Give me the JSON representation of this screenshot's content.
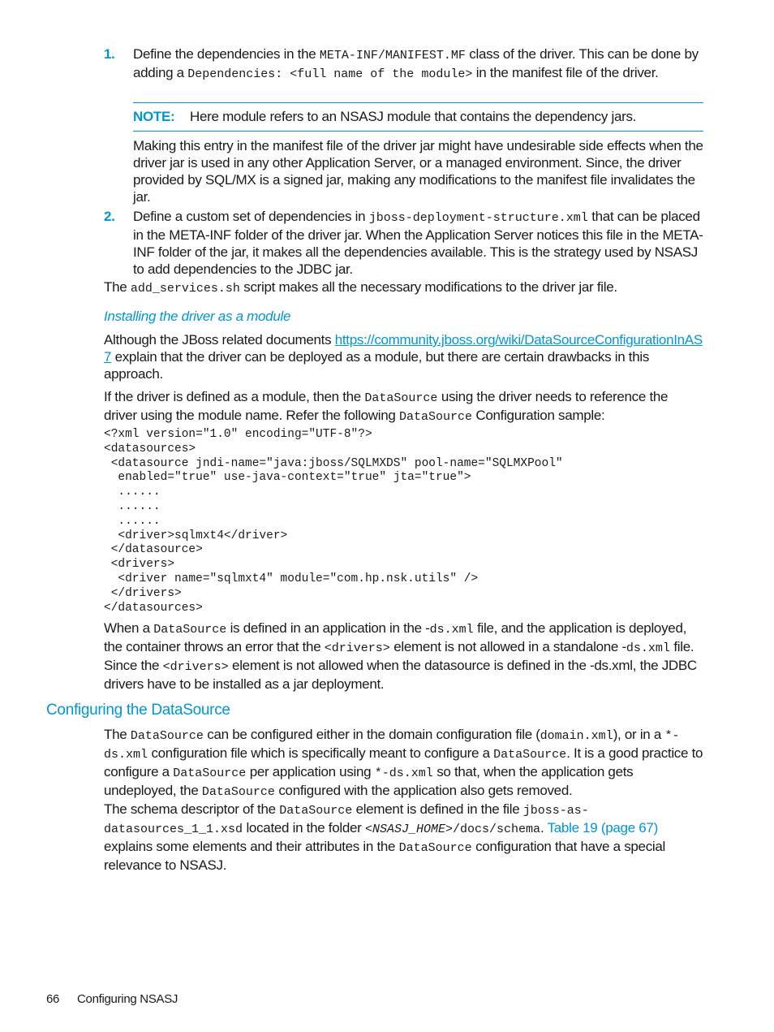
{
  "step1": {
    "number": "1.",
    "text_a": "Define the dependencies in the ",
    "code_a": "META-INF/MANIFEST.MF",
    "text_b": " class of the driver. This can be done by adding a ",
    "code_b": "Dependencies: <full name of the module>",
    "text_c": " in the manifest file of the driver."
  },
  "note": {
    "label": "NOTE:",
    "text": "Here module refers to an NSASJ module that contains the dependency jars."
  },
  "step1_followup": "Making this entry in the manifest file of the driver jar might have undesirable side effects when the driver jar is used in any other Application Server, or a managed environment. Since, the driver provided by SQL/MX is a signed jar, making any modifications to the manifest file invalidates the jar.",
  "step2": {
    "number": "2.",
    "text_a": "Define a custom set of dependencies in ",
    "code_a": "jboss-deployment-structure.xml",
    "text_b": " that can be placed in the META-INF folder of the driver jar. When the Application Server notices this file in the META-INF folder of the jar, it makes all the dependencies available. This is the strategy used by NSASJ to add dependencies to the JDBC jar."
  },
  "add_services": {
    "text_a": "The ",
    "code_a": "add_services.sh",
    "text_b": " script makes all the necessary modifications to the driver jar file."
  },
  "subheading": "Installing the driver as a module",
  "jboss_para": {
    "text_a": "Although the JBoss related documents ",
    "link": "https://community.jboss.org/wiki/DataSourceConfigurationInAS7",
    "text_b": " explain that the driver can be deployed as a module, but there are certain drawbacks in this approach."
  },
  "module_para": {
    "text_a": "If the driver is defined as a module, then the ",
    "code_a": "DataSource",
    "text_b": " using the driver needs to reference the driver using the module name. Refer the following ",
    "code_b": "DataSource",
    "text_c": " Configuration sample:"
  },
  "code_sample": "<?xml version=\"1.0\" encoding=\"UTF-8\"?>\n<datasources>\n <datasource jndi-name=\"java:jboss/SQLMXDS\" pool-name=\"SQLMXPool\"\n  enabled=\"true\" use-java-context=\"true\" jta=\"true\">\n  ......\n  ......\n  ......\n  <driver>sqlmxt4</driver>\n </datasource>\n <drivers>\n  <driver name=\"sqlmxt4\" module=\"com.hp.nsk.utils\" />\n </drivers>\n</datasources>",
  "ds_xml_para": {
    "text_a": "When a ",
    "code_a": "DataSource",
    "text_b": " is defined in an application in the -",
    "code_b": "ds.xml",
    "text_c": " file, and the application is deployed, the container throws an error that the ",
    "code_c": "<drivers>",
    "text_d": " element is not allowed in a standalone -",
    "code_d": "ds.xml",
    "text_e": " file. Since the ",
    "code_e": "<drivers>",
    "text_f": " element is not allowed when the datasource is defined in the -ds.xml, the JDBC drivers have to be installed as a jar deployment."
  },
  "section_heading": "Configuring the DataSource",
  "config_para": {
    "text_a": "The ",
    "code_a": "DataSource",
    "text_b": " can be configured either in the domain configuration file (",
    "code_b": "domain.xml",
    "text_c": "), or in a ",
    "code_c": "*-ds.xml",
    "text_d": " configuration file which is specifically meant to configure a ",
    "code_d": "DataSource",
    "text_e": ". It is a good practice to configure a ",
    "code_e": "DataSource",
    "text_f": " per application using ",
    "code_f": "*-ds.xml",
    "text_g": " so that, when the application gets undeployed, the ",
    "code_g": "DataSource",
    "text_h": " configured with the application also gets removed."
  },
  "schema_para": {
    "text_a": "The schema descriptor of the ",
    "code_a": "DataSource",
    "text_b": " element is defined in the file ",
    "code_b": "jboss-as-datasources_1_1.xsd",
    "text_c": " located in the folder ",
    "code_c_open": "<",
    "code_c_ital": "NSASJ_HOME",
    "code_c_close": ">/docs/schema",
    "text_d": ". ",
    "xref": "Table 19 (page 67)",
    "text_e": " explains some elements and their attributes in the ",
    "code_e": "DataSource",
    "text_f": " configuration that have a special relevance to NSASJ."
  },
  "footer": {
    "page_number": "66",
    "chapter": "Configuring NSASJ"
  }
}
